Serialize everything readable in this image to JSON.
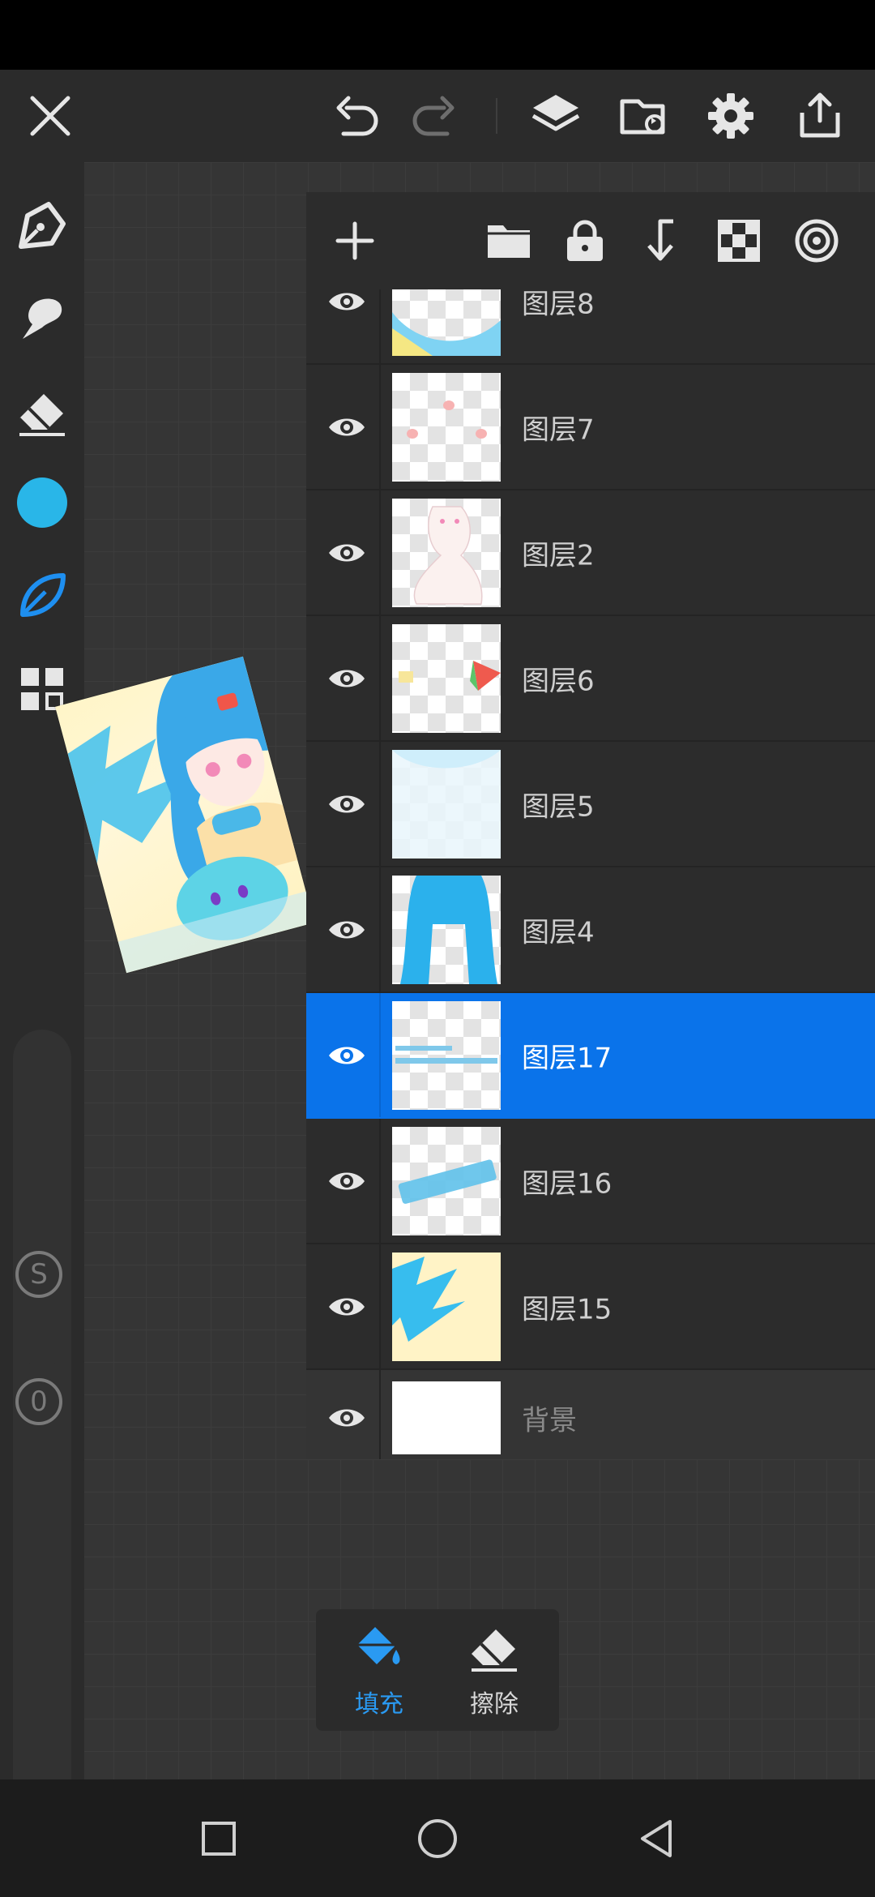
{
  "colors": {
    "accent": "#0a73ea",
    "current_color": "#29b6e8",
    "icon": "#e6e6e6"
  },
  "toolbar": {
    "icons": [
      "close-icon",
      "undo-icon",
      "redo-icon",
      "layers-icon",
      "import-icon",
      "gear-icon",
      "share-icon"
    ]
  },
  "sidebar": {
    "tools": [
      "pen-icon",
      "smudge-icon",
      "eraser-icon",
      "color-swatch",
      "leaf-brush-icon",
      "gallery-icon"
    ],
    "size_badge": "S",
    "opacity_badge": "0"
  },
  "layers_header": {
    "icons": [
      "add-icon",
      "folder-icon",
      "lock-icon",
      "merge-down-icon",
      "checker-icon",
      "target-icon"
    ]
  },
  "layers": [
    {
      "name": "图层8",
      "selected": false
    },
    {
      "name": "图层7",
      "selected": false
    },
    {
      "name": "图层2",
      "selected": false
    },
    {
      "name": "图层6",
      "selected": false
    },
    {
      "name": "图层5",
      "selected": false
    },
    {
      "name": "图层4",
      "selected": false
    },
    {
      "name": "图层17",
      "selected": true
    },
    {
      "name": "图层16",
      "selected": false
    },
    {
      "name": "图层15",
      "selected": false
    },
    {
      "name": "背景",
      "selected": false
    }
  ],
  "fill_panel": {
    "fill_label": "填充",
    "erase_label": "擦除"
  }
}
